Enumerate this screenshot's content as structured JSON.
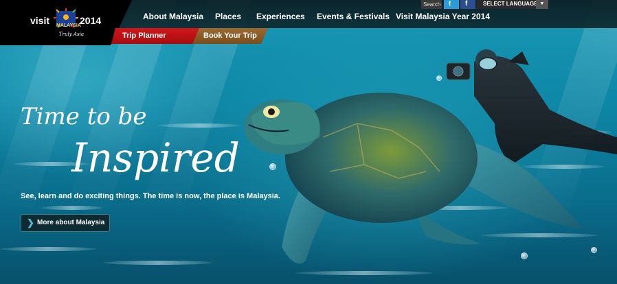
{
  "logo": {
    "visit": "visit",
    "country": "MALAYSIA",
    "year": "2014",
    "tagline": "Truly Asia"
  },
  "nav": {
    "items": [
      {
        "label": "About Malaysia"
      },
      {
        "label": "Places"
      },
      {
        "label": "Experiences"
      },
      {
        "label": "Events & Festivals"
      },
      {
        "label": "Visit Malaysia Year 2014"
      }
    ],
    "trip_planner": "Trip Planner",
    "book_trip": "Book Your Trip"
  },
  "utility": {
    "search_label": "Search",
    "twitter_icon": "t",
    "facebook_icon": "f",
    "language_label": "SELECT LANGUAGE",
    "language_arrow": "▼"
  },
  "hero": {
    "headline_line1": "Time to be",
    "headline_line2": "Inspired",
    "subtext": "See, learn and do exciting things. The time is now, the place is Malaysia.",
    "cta_label": "More about Malaysia",
    "cta_icon": "❯"
  },
  "colors": {
    "trip_planner": "#c1121a",
    "book_trip": "#8c5c26",
    "ocean": "#0e87a7"
  }
}
